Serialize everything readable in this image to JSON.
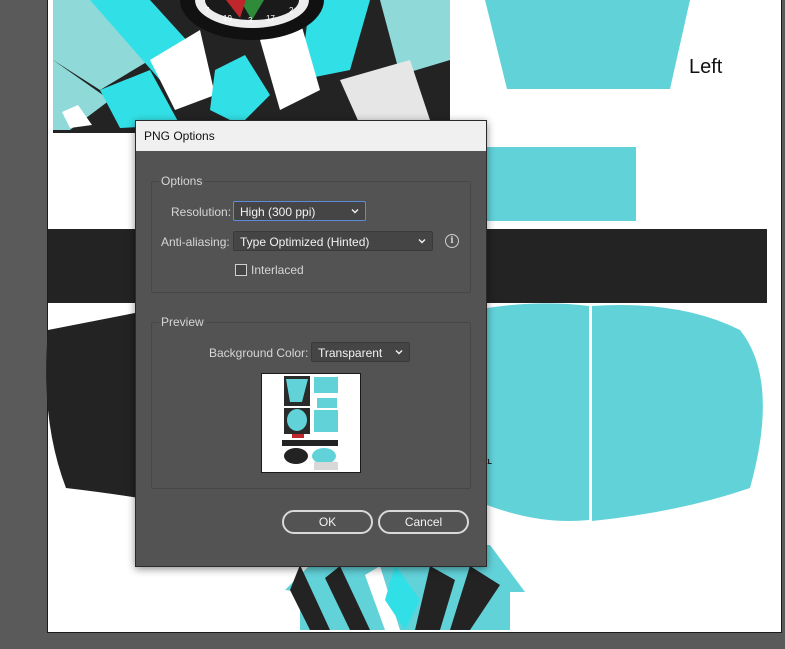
{
  "canvas": {
    "left_label": "Left",
    "size_tag": "XL",
    "dartboard_numbers": [
      "7",
      "19",
      "3",
      "17",
      "2"
    ]
  },
  "dialog": {
    "title": "PNG Options",
    "options_group": {
      "legend": "Options",
      "resolution_label": "Resolution:",
      "resolution_value": "High (300 ppi)",
      "antialiasing_label": "Anti-aliasing:",
      "antialiasing_value": "Type Optimized (Hinted)",
      "interlaced_label": "Interlaced",
      "interlaced_checked": false
    },
    "preview_group": {
      "legend": "Preview",
      "background_label": "Background Color:",
      "background_value": "Transparent"
    },
    "ok_label": "OK",
    "cancel_label": "Cancel"
  },
  "colors": {
    "teal": "#62d2d9",
    "dark": "#232323",
    "dialog_bg": "#535353",
    "canvas_bg": "#5a5a5a"
  }
}
